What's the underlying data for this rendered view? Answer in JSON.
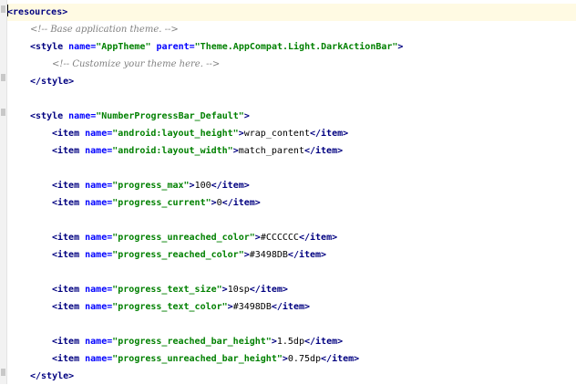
{
  "editor": {
    "line1": {
      "open": "<",
      "tag": "resources",
      "close": ">"
    },
    "line2": {
      "comment": "<!-- Base application theme. -->"
    },
    "line3": {
      "open": "<",
      "tag": "style",
      "attr1": " name=",
      "val1": "\"AppTheme\"",
      "attr2": " parent=",
      "val2": "\"Theme.AppCompat.Light.DarkActionBar\"",
      "close": ">"
    },
    "line4": {
      "comment": "<!-- Customize your theme here. -->"
    },
    "line5": {
      "text": "</style>"
    },
    "line7": {
      "open": "<",
      "tag": "style",
      "attr1": " name=",
      "val1": "\"NumberProgressBar_Default\"",
      "close": ">"
    },
    "item_rows": [
      {
        "name": "\"android:layout_height\"",
        "value": "wrap_content"
      },
      {
        "name": "\"android:layout_width\"",
        "value": "match_parent"
      },
      {
        "name": "\"progress_max\"",
        "value": "100"
      },
      {
        "name": "\"progress_current\"",
        "value": "0"
      },
      {
        "name": "\"progress_unreached_color\"",
        "value": "#CCCCCC"
      },
      {
        "name": "\"progress_reached_color\"",
        "value": "#3498DB"
      },
      {
        "name": "\"progress_text_size\"",
        "value": "10sp"
      },
      {
        "name": "\"progress_text_color\"",
        "value": "#3498DB"
      },
      {
        "name": "\"progress_reached_bar_height\"",
        "value": "1.5dp"
      },
      {
        "name": "\"progress_unreached_bar_height\"",
        "value": "0.75dp"
      }
    ],
    "item_open": "<item",
    "item_attr": " name=",
    "item_gt": ">",
    "item_close": "</item>",
    "line_last": {
      "text": "</style>"
    }
  }
}
